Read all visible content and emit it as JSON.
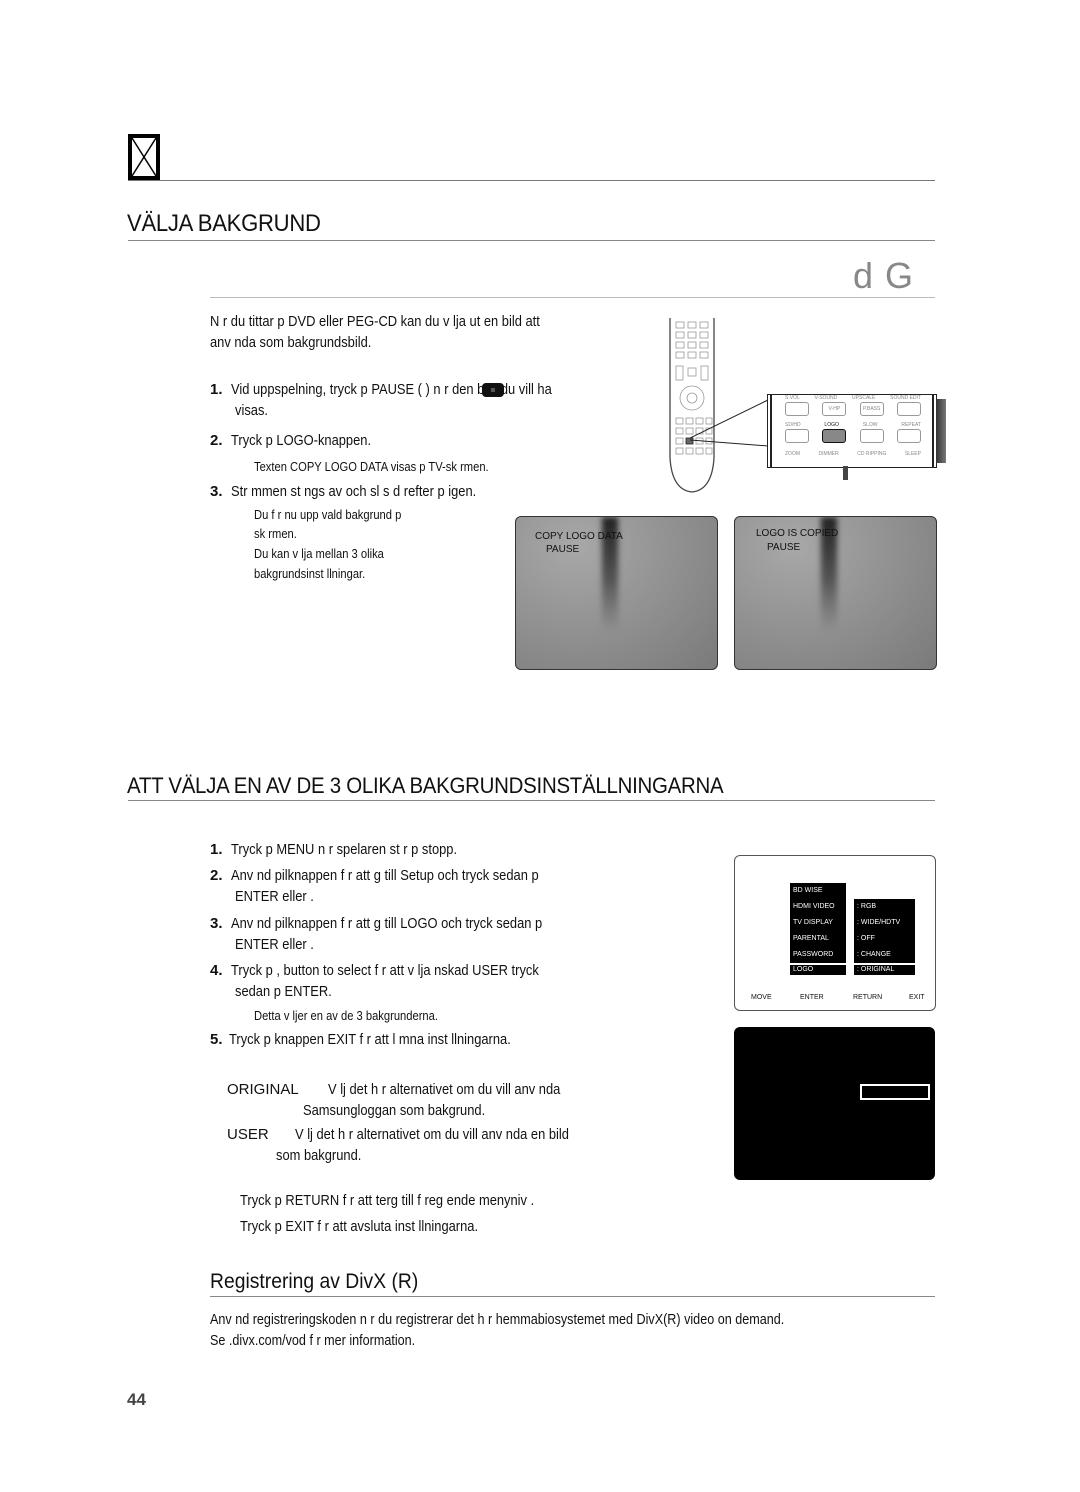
{
  "header": {
    "icon": "box-with-x-icon",
    "section_title": "VÄLJA BAKGRUND",
    "disc_badges": "d G"
  },
  "intro": {
    "line1": "N    r du tittar p     DVD eller     PEG-CD kan du v    lja ut en bild att",
    "line2": "anv    nda som bakgrundsbild."
  },
  "steps_a": [
    {
      "num": "1.",
      "line1": "Vid uppspelning, tryck p        PAUSE (    ) n    r den bild du vill ha",
      "line2": "visas."
    },
    {
      "num": "2.",
      "line1": "Tryck p     LOGO-knappen.",
      "note": "Texten  COPY LOGO DATA visas p     TV-sk    rmen."
    },
    {
      "num": "3.",
      "line1": "Str    mmen st    ngs av och sl    s d    refter p     igen.",
      "notes": [
        "Du f    r nu upp vald bakgrund p",
        "sk    rmen.",
        "Du kan v    lja mellan 3 olika",
        "bakgrundsinst    llningar."
      ]
    }
  ],
  "remote": {
    "top_labels": [
      "S.VOL",
      "V-SOUND",
      "UPSCALE",
      "SOUND EDIT"
    ],
    "top_buttons": [
      "",
      "V-HP",
      "P.BASS",
      ""
    ],
    "mid_labels": [
      "SD/HD",
      "LOGO",
      "SLOW",
      "REPEAT"
    ],
    "bottom_labels": [
      "ZOOM",
      "DIMMER",
      "CD RIPPING",
      "SLEEP"
    ]
  },
  "tv_screens": [
    {
      "line1": "COPY LOGO DATA",
      "line2": "PAUSE"
    },
    {
      "line1": "LOGO IS COPIED",
      "line2": "PAUSE"
    }
  ],
  "section2": {
    "title": "ATT VÄLJA EN AV DE 3 OLIKA BAKGRUNDSINSTÄLLNINGARNA",
    "steps": [
      {
        "num": "1.",
        "line1": "Tryck p     MENU n    r spelaren st    r p     stopp."
      },
      {
        "num": "2.",
        "line1": "Anv    nd pilknappen        f    r att g     till Setup och tryck sedan p",
        "line2": "ENTER eller     ."
      },
      {
        "num": "3.",
        "line1": "Anv    nd pilknappen        f    r att g     till LOGO och tryck sedan p",
        "line2": "ENTER eller     ."
      },
      {
        "num": "4.",
        "line1": "Tryck p         ,    button to select f    r att v    lja     nskad USER     tryck",
        "line2": "sedan p     ENTER.",
        "note": "Detta v    ljer en av de 3 bakgrunderna."
      },
      {
        "num": "5.",
        "line1": "Tryck p     knappen   EXIT f    r att l    mna inst    llningarna."
      }
    ],
    "options": [
      {
        "label": "ORIGINAL",
        "line1": "V    lj det h    r alternativet om du vill anv    nda",
        "line2": "Samsungloggan som bakgrund."
      },
      {
        "label": "USER",
        "line1": "V    lj det h    r alternativet om du vill anv    nda en bild",
        "line2": "som bakgrund."
      }
    ],
    "tips": [
      "Tryck p     RETURN f    r att     terg     till f    reg     ende menyniv     .",
      "Tryck p     EXIT f    r att avsluta inst    llningarna."
    ]
  },
  "setup_menu": {
    "left_items": [
      "BD WISE",
      "HDMI VIDEO OU",
      "TV DISPLAY",
      "PARENTAL",
      "PASSWORD",
      "LOGO"
    ],
    "right_values": [
      ": RGB",
      ": WIDE/HDTV",
      ": OFF",
      ": CHANGE",
      ": ORIGINAL"
    ],
    "footer": [
      "MOVE",
      "ENTER",
      "RETURN",
      "EXIT"
    ]
  },
  "section3": {
    "title": "Registrering av DivX (R)",
    "line1": "Anv    nd registreringskoden n    r du registrerar det h    r hemmabiosystemet med DivX(R) video on demand.",
    "line2": "Se            .divx.com/vod f    r mer information."
  },
  "page_number": "44"
}
